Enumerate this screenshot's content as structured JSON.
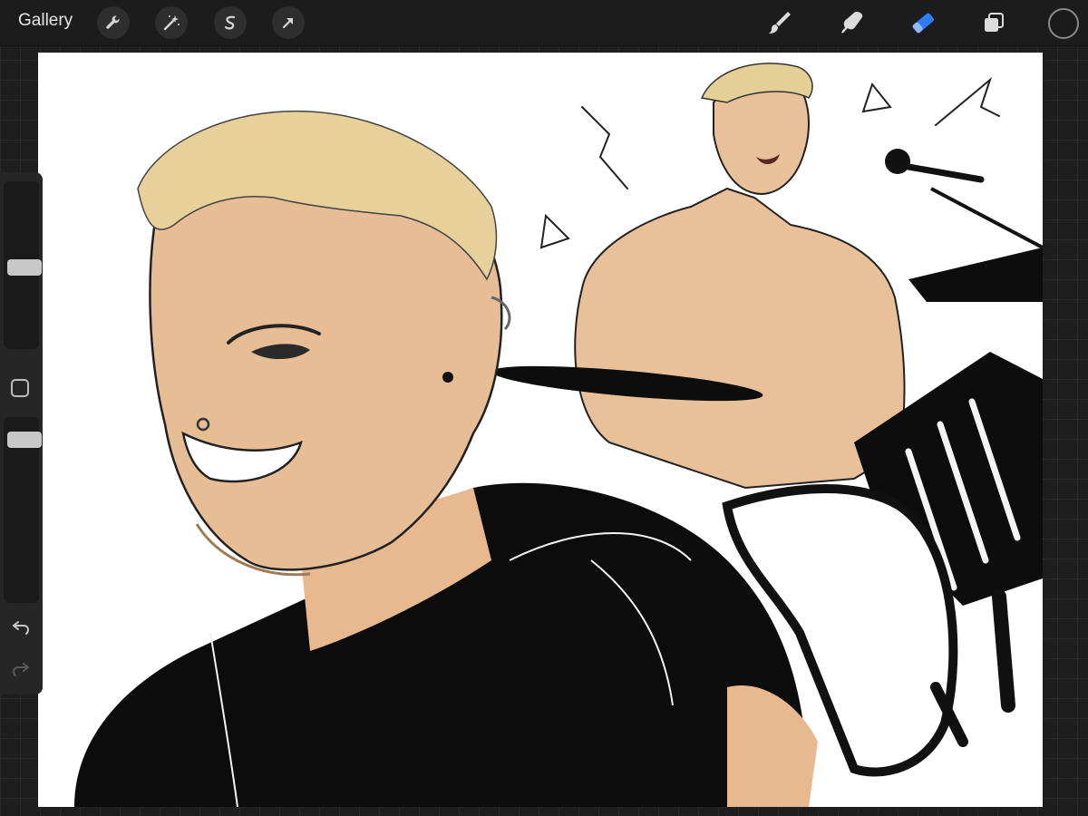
{
  "toolbar": {
    "gallery_label": "Gallery",
    "left_tools": [
      "wrench-icon",
      "magic-wand-icon",
      "selection-icon",
      "transform-arrow-icon"
    ],
    "right_tools": [
      "brush-icon",
      "smudge-icon",
      "eraser-icon",
      "layers-icon"
    ],
    "active_tool": "eraser-icon",
    "active_color": "#1a1a1a",
    "accent_color": "#2f7cf6"
  },
  "sidebar": {
    "controls": [
      "brush-size-slider",
      "modify-button",
      "opacity-slider",
      "undo-icon",
      "redo-icon"
    ]
  },
  "canvas": {
    "content": "artwork",
    "background_color": "#ffffff"
  }
}
